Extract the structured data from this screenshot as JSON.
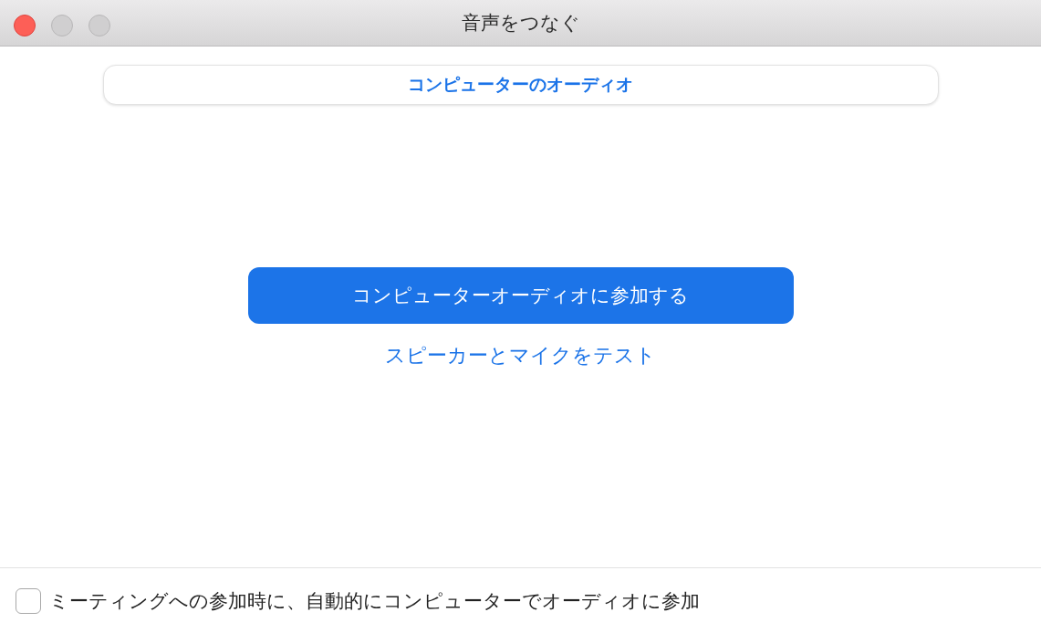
{
  "window": {
    "title": "音声をつなぐ"
  },
  "tabs": [
    {
      "label": "コンピューターのオーディオ",
      "selected": true
    }
  ],
  "join_button": {
    "label": "コンピューターオーディオに参加する"
  },
  "test_link": {
    "label": "スピーカーとマイクをテスト"
  },
  "auto_join": {
    "label": "ミーティングへの参加時に、自動的にコンピューターでオーディオに参加",
    "checked": false
  }
}
